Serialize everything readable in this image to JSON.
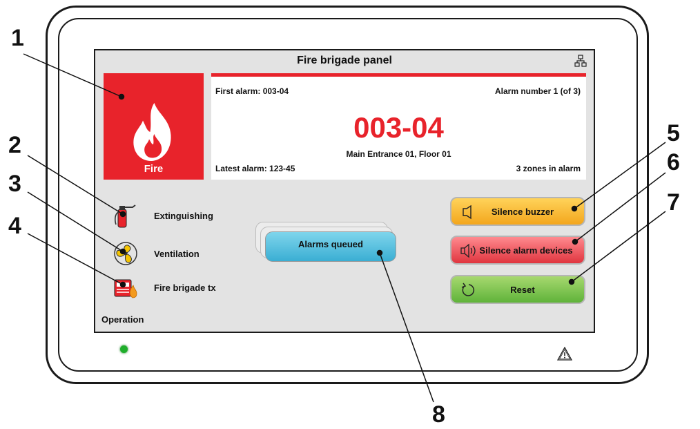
{
  "callouts": [
    "1",
    "2",
    "3",
    "4",
    "5",
    "6",
    "7",
    "8"
  ],
  "panel": {
    "title": "Fire brigade panel",
    "network_icon": "network-icon"
  },
  "fire_tile": {
    "label": "Fire",
    "icon": "flame-icon",
    "color": "#e8232b"
  },
  "alarm": {
    "first": "First alarm: 003-04",
    "number": "Alarm number 1 (of 3)",
    "code": "003-04",
    "location": "Main Entrance 01, Floor 01",
    "latest": "Latest alarm: 123-45",
    "zones": "3 zones in alarm",
    "code_color": "#e8232b"
  },
  "status": [
    {
      "label": "Extinguishing",
      "icon": "fire-extinguisher-icon"
    },
    {
      "label": "Ventilation",
      "icon": "fan-icon"
    },
    {
      "label": "Fire brigade tx",
      "icon": "fire-truck-icon"
    }
  ],
  "operation_label": "Operation",
  "queue": {
    "label": "Alarms queued"
  },
  "buttons": {
    "silence_buzzer": {
      "label": "Silence buzzer",
      "icon": "buzzer-icon",
      "color": "#f3a61d"
    },
    "silence_alarm_devices": {
      "label": "Silence alarm devices",
      "icon": "speaker-icon",
      "color": "#e0353f"
    },
    "reset": {
      "label": "Reset",
      "icon": "reset-icon",
      "color": "#5fb33a"
    }
  },
  "indicators": {
    "led": "power-led",
    "led_color": "#1fae2b",
    "warning": "warning-icon"
  }
}
